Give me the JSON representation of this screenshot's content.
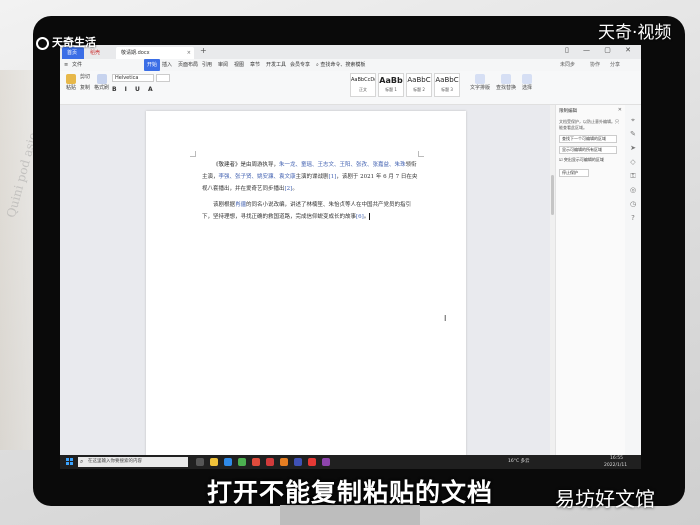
{
  "watermarks": {
    "brand_left": "天奇生活",
    "brand_right": "天奇·视频",
    "bottom_right": "易坊好文馆"
  },
  "subtitle": "打开不能复制粘贴的文档",
  "background": {
    "paper_text": "Quini pod\nasio"
  },
  "tabs": {
    "home": "首页",
    "daoke": "稻壳",
    "doc": "敬请期.docx",
    "add": "+"
  },
  "menu": {
    "file": "文件",
    "start": "开始",
    "insert": "插入",
    "layout": "页面布局",
    "ref": "引用",
    "review": "审阅",
    "view": "视图",
    "chapter": "章节",
    "dev": "开发工具",
    "member": "会员专享",
    "search": "查找命令、搜索模板",
    "sync": "未同步",
    "share": "协作",
    "share2": "分享"
  },
  "ribbon": {
    "paste": "粘贴",
    "cut": "剪切",
    "copy": "复制",
    "format_painter": "格式刷",
    "font": "Helvetica",
    "size": "",
    "format_row": "B I U A",
    "styles": [
      {
        "sample": "AaBbCcDd",
        "name": "正文"
      },
      {
        "sample": "AaBb",
        "name": "标题 1"
      },
      {
        "sample": "AaBbC",
        "name": "标题 2"
      },
      {
        "sample": "AaBbC",
        "name": "标题 3"
      }
    ],
    "text_tools": "文字排版",
    "find_replace": "查找替换",
    "select": "选择"
  },
  "document": {
    "p1_a": "《敬建者》是由周游执导，",
    "p1_names": "朱一龙、童瑶、王志文、王阳、张孜、张嘉益、朱珠",
    "p1_b": "领衔主演，",
    "p1_names2": "李强、张子贤、姚安濂、袁文康",
    "p1_c": "主演的谍战剧",
    "p1_ref1": "[1]",
    "p1_d": "，该剧于 2021 年 6 月 7 日在央视八套播出，并在爱奇艺同步播出",
    "p1_ref2": "[2]",
    "p1_e": "。",
    "p2_a": "该剧根据",
    "p2_name": "肖疆",
    "p2_b": "的同名小说改编，讲述了林楠笙、朱怡贞等人在中国共产党员的指引下，坚持理想，寻找正确的救国道路，完成信仰蜕变成长的故事",
    "p2_ref": "[6]",
    "p2_c": "。"
  },
  "panel": {
    "title": "限制编辑",
    "desc": "文档受保护，以防止意外编辑。只能查看此区域。",
    "btn1": "查找下一个可编辑的区域",
    "btn2": "显示可编辑的所有区域",
    "check": "突出显示可编辑的区域",
    "btn3": "停止保护"
  },
  "status": {
    "page": "页面: 1/1",
    "words": "字数: 149",
    "spell": "拼写检查",
    "proof": "文档校对",
    "protect": "编辑受限",
    "missing_font": "缺失字体",
    "zoom": "110%"
  },
  "taskbar": {
    "search_placeholder": "在这里输入你要搜索的内容",
    "weather": "16°C 多云",
    "time": "16:55",
    "date": "2022/1/11"
  }
}
